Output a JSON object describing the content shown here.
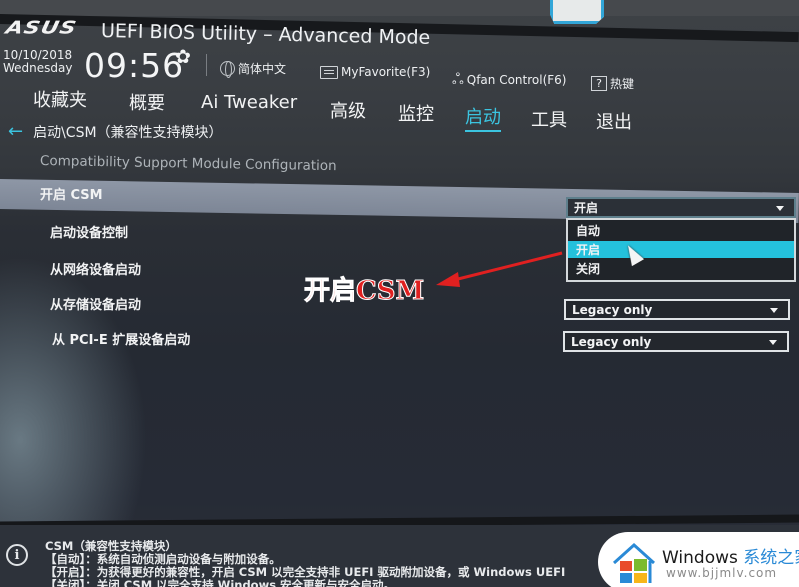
{
  "header": {
    "brand": "ASUS",
    "title": "UEFI BIOS Utility – Advanced Mode",
    "date": "10/10/2018",
    "weekday": "Wednesday",
    "time": "09:56",
    "settings_icon": "gear-icon",
    "toolbar": [
      {
        "icon": "globe-icon",
        "label": "简体中文"
      },
      {
        "icon": "favorite-icon",
        "label": "MyFavorite(F3)"
      },
      {
        "icon": "fan-icon",
        "label": "Qfan Control(F6)"
      },
      {
        "icon": "help-icon",
        "label": "热键"
      }
    ]
  },
  "tabs": [
    {
      "label": "收藏夹",
      "active": false
    },
    {
      "label": "概要",
      "active": false
    },
    {
      "label": "Ai Tweaker",
      "active": false
    },
    {
      "label": "高级",
      "active": false
    },
    {
      "label": "监控",
      "active": false
    },
    {
      "label": "启动",
      "active": true
    },
    {
      "label": "工具",
      "active": false
    },
    {
      "label": "退出",
      "active": false
    }
  ],
  "breadcrumb": {
    "back_icon": "back-arrow-icon",
    "path": "启动\\CSM（兼容性支持模块）",
    "subtitle": "Compatibility Support Module Configuration"
  },
  "settings": [
    {
      "label": "开启 CSM",
      "value": "开启",
      "selected": true
    },
    {
      "label": "启动设备控制",
      "value": ""
    },
    {
      "label": "从网络设备启动",
      "value": ""
    },
    {
      "label": "从存储设备启动",
      "value": "Legacy only"
    },
    {
      "label": "从 PCI-E 扩展设备启动",
      "value": "Legacy only"
    }
  ],
  "dropdown": {
    "options": [
      "自动",
      "开启",
      "关闭"
    ],
    "highlighted": "开启"
  },
  "annotation": {
    "text": "开启CSM",
    "color": "#e02020"
  },
  "help": {
    "title": "CSM（兼容性支持模块）",
    "lines": [
      "【自动】：系统自动侦测启动设备与附加设备。",
      "【开启】：为获得更好的兼容性，开启 CSM 以完全支持非 UEFI 驱动附加设备，或 Windows UEFI",
      "【关闭】：关闭 CSM 以完全支持 Windows 安全更新与安全启动。"
    ]
  },
  "watermark": {
    "brand_en": "Windows",
    "brand_cn": "系统之家",
    "url": "www.bjjmlv.com"
  },
  "colors": {
    "accent": "#3bc4e0",
    "highlight_row": "#8a93a2",
    "dropdown_highlight": "#24c1dc"
  }
}
